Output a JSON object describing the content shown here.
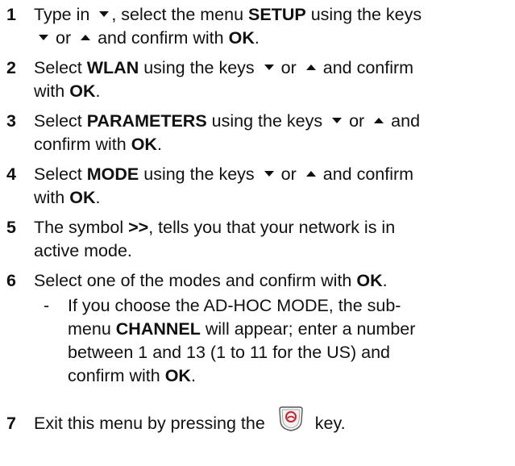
{
  "steps": [
    {
      "number": "1",
      "parts": {
        "a": "Type in",
        "b": ", select the menu",
        "c": "SETUP",
        "d": "using the keys",
        "e": "or",
        "f": "and confirm with",
        "g": "OK",
        "h": "."
      }
    },
    {
      "number": "2",
      "parts": {
        "a": "Select",
        "b": "WLAN",
        "c": "using the keys",
        "d": "or",
        "e": "and confirm",
        "f": "with",
        "g": "OK",
        "h": "."
      }
    },
    {
      "number": "3",
      "parts": {
        "a": "Select",
        "b": "PARAMETERS",
        "c": "using the keys",
        "d": "or",
        "e": "and",
        "f": "confirm with",
        "g": "OK",
        "h": "."
      }
    },
    {
      "number": "4",
      "parts": {
        "a": "Select",
        "b": "MODE",
        "c": "using the keys",
        "d": "or",
        "e": "and confirm",
        "f": "with",
        "g": "OK",
        "h": "."
      }
    },
    {
      "number": "5",
      "parts": {
        "a": "The symbol",
        "b": ">>",
        "c": ", tells you that your network is in",
        "d": "active mode."
      }
    },
    {
      "number": "6",
      "parts": {
        "a": "Select one of the modes and confirm with",
        "b": "OK",
        "c": "."
      },
      "sub": {
        "dash": "-",
        "l1": "If you choose the AD-HOC MODE, the sub-",
        "l2a": "menu",
        "l2b": "CHANNEL",
        "l2c": "will appear; enter a number",
        "l3": "between 1 and 13 (1 to 11 for the US) and",
        "l4a": "confirm with",
        "l4b": "OK",
        "l4c": "."
      }
    },
    {
      "number": "7",
      "parts": {
        "a": "Exit this menu by pressing the",
        "b": "key."
      },
      "key_icon": "red-end-call-key-icon"
    }
  ],
  "colors": {
    "text": "#111111",
    "key_red": "#d0202a"
  }
}
